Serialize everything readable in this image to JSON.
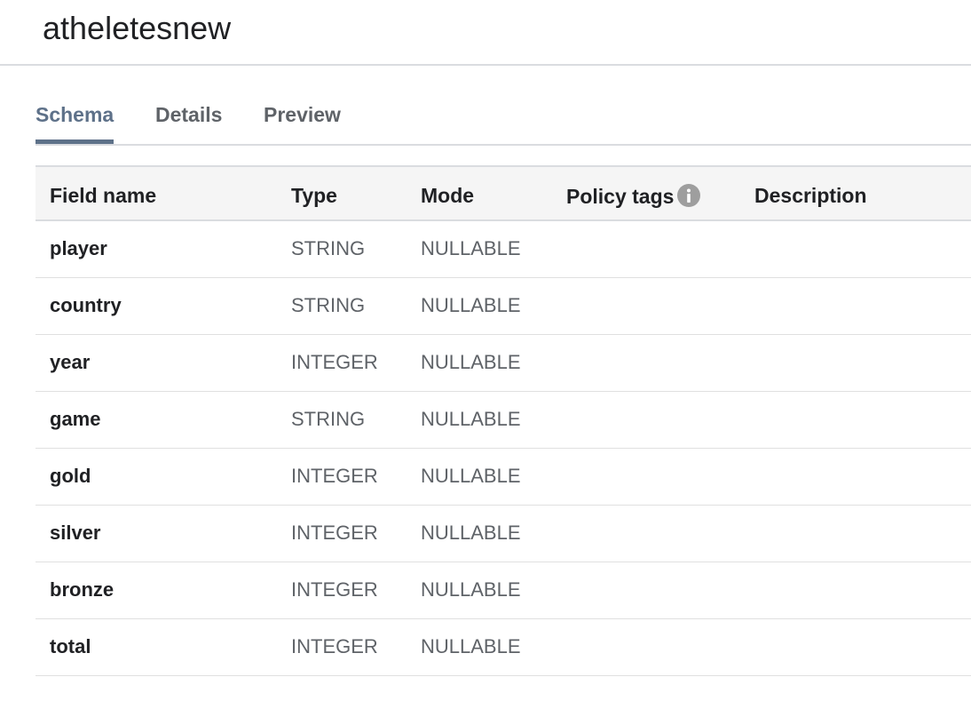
{
  "title": "atheletesnew",
  "tabs": [
    {
      "label": "Schema",
      "active": true
    },
    {
      "label": "Details",
      "active": false
    },
    {
      "label": "Preview",
      "active": false
    }
  ],
  "table": {
    "headers": {
      "field_name": "Field name",
      "type": "Type",
      "mode": "Mode",
      "policy_tags": "Policy tags",
      "description": "Description"
    },
    "rows": [
      {
        "name": "player",
        "type": "STRING",
        "mode": "NULLABLE"
      },
      {
        "name": "country",
        "type": "STRING",
        "mode": "NULLABLE"
      },
      {
        "name": "year",
        "type": "INTEGER",
        "mode": "NULLABLE"
      },
      {
        "name": "game",
        "type": "STRING",
        "mode": "NULLABLE"
      },
      {
        "name": "gold",
        "type": "INTEGER",
        "mode": "NULLABLE"
      },
      {
        "name": "silver",
        "type": "INTEGER",
        "mode": "NULLABLE"
      },
      {
        "name": "bronze",
        "type": "INTEGER",
        "mode": "NULLABLE"
      },
      {
        "name": "total",
        "type": "INTEGER",
        "mode": "NULLABLE"
      }
    ]
  },
  "icons": {
    "policy_tags_info": "info-icon"
  },
  "colors": {
    "active_tab": "#5e7189",
    "header_bg": "#f5f5f5",
    "divider": "#dadce0"
  }
}
